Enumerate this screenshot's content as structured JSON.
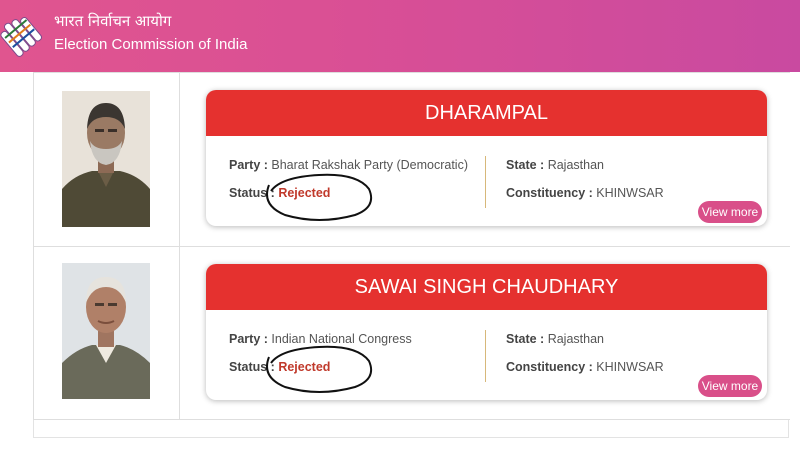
{
  "header": {
    "org_hindi": "भारत निर्वाचन आयोग",
    "org_english": "Election Commission of India",
    "logo_icon": "ballot-finger-logo-icon"
  },
  "candidates": [
    {
      "name": "DHARAMPAL",
      "party_label": "Party :",
      "party": "Bharat Rakshak Party (Democratic)",
      "status_label": "Status :",
      "status": "Rejected",
      "state_label": "State :",
      "state": "Rajasthan",
      "constituency_label": "Constituency :",
      "constituency": "KHINWSAR",
      "view_more": "View more"
    },
    {
      "name": "SAWAI SINGH CHAUDHARY",
      "party_label": "Party :",
      "party": "Indian National Congress",
      "status_label": "Status :",
      "status": "Rejected",
      "state_label": "State :",
      "state": "Rajasthan",
      "constituency_label": "Constituency :",
      "constituency": "KHINWSAR",
      "view_more": "View more"
    }
  ],
  "colors": {
    "header_gradient_start": "#e0558f",
    "header_gradient_end": "#c94aa0",
    "card_title_bg": "#e5312f",
    "status_rejected": "#c0392b",
    "view_more_bg": "#d94f89"
  }
}
